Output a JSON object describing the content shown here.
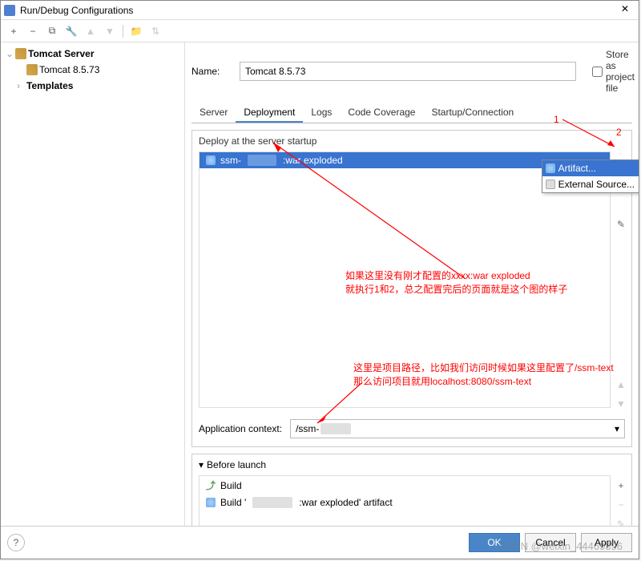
{
  "window": {
    "title": "Run/Debug Configurations"
  },
  "toolbar": {
    "add": "+",
    "remove": "−",
    "copy": "⧉",
    "wrench": "🔧",
    "up": "▲",
    "down": "▼",
    "folder": "📁",
    "sort": "⇅"
  },
  "tree": {
    "server_group": "Tomcat Server",
    "server_item": "Tomcat 8.5.73",
    "templates": "Templates"
  },
  "form": {
    "name_label": "Name:",
    "name_value": "Tomcat 8.5.73",
    "store_label": "Store as project file"
  },
  "tabs": {
    "server": "Server",
    "deployment": "Deployment",
    "logs": "Logs",
    "coverage": "Code Coverage",
    "startup": "Startup/Connection"
  },
  "deploy": {
    "header": "Deploy at the server startup",
    "item_prefix": "ssm-",
    "item_suffix": ":war exploded",
    "app_context_label": "Application context:",
    "app_context_value": "/ssm-"
  },
  "popup": {
    "artifact": "Artifact...",
    "external": "External Source..."
  },
  "before_launch": {
    "header": "Before launch",
    "build": "Build",
    "build_artifact_prefix": "Build '",
    "build_artifact_suffix": ":war exploded' artifact"
  },
  "annotations": {
    "marker1": "1",
    "marker2": "2",
    "note1_line1": "如果这里没有刚才配置的xxxx:war exploded",
    "note1_line2": "就执行1和2，总之配置完后的页面就是这个图的样子",
    "note2_line1": "这里是项目路径，比如我们访问时候如果这里配置了/ssm-text",
    "note2_line2": "那么访问项目就用localhost:8080/ssm-text"
  },
  "footer": {
    "ok": "OK",
    "cancel": "Cancel",
    "apply": "Apply"
  },
  "watermark": "CSDN @weixin_44469396"
}
